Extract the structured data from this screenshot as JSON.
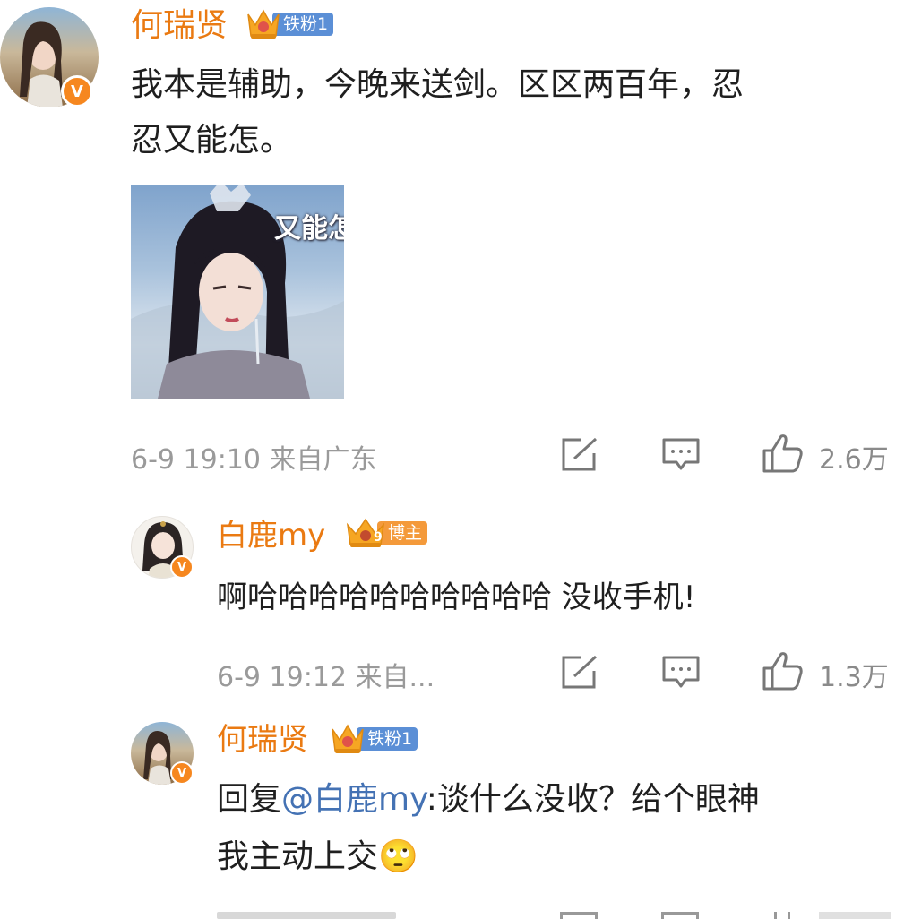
{
  "comments": [
    {
      "username": "何瑞贤",
      "badge": "铁粉1",
      "text_lines": [
        "我本是辅助，今晚来送剑。区区两百年，忍",
        "忍又能怎。"
      ],
      "image_overlay_text": "又能怎",
      "meta": "6-9 19:10 来自广东",
      "like_count": "2.6万"
    },
    {
      "username": "白鹿my",
      "badge": "博主",
      "badge_level": "9",
      "text": "啊哈哈哈哈哈哈哈哈哈哈 没收手机!",
      "meta": "6-9 19:12 来自...",
      "like_count": "1.3万"
    },
    {
      "username": "何瑞贤",
      "badge": "铁粉1",
      "reply_prefix": "回复",
      "mention": "@白鹿my",
      "text_line1": ":谈什么没收？给个眼神",
      "text_line2": "我主动上交",
      "emoji": "🙄"
    }
  ],
  "colors": {
    "username": "#ea7a12",
    "fan_badge": "#5b8fd6",
    "blogger_badge": "#f49a3b",
    "mention": "#4472b4",
    "meta": "#9a9a9a"
  },
  "icons": [
    "verified-v-icon",
    "crown-icon",
    "repost-icon",
    "comment-icon",
    "like-icon"
  ]
}
